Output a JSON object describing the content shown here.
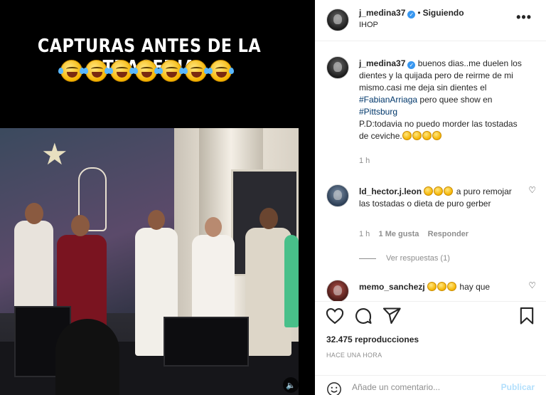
{
  "media": {
    "caption": "CAPTURAS ANTES DE LA TRAGEDIA",
    "emoji_row": [
      "rolling-on-floor-laughing",
      "rolling-on-floor-laughing",
      "rolling-on-floor-laughing",
      "rolling-on-floor-laughing",
      "rolling-on-floor-laughing",
      "rolling-on-floor-laughing",
      "rolling-on-floor-laughing"
    ],
    "volume_icon": "speaker-icon"
  },
  "header": {
    "username": "j_medina37",
    "separator": "•",
    "follow_status": "Siguiendo",
    "location": "IHOP",
    "more_icon": "•••"
  },
  "post_caption": {
    "username": "j_medina37",
    "text_1": "buenos dias..me duelen los dientes y la quijada pero de reirme de mi mismo.casi me deja sin dientes el",
    "hashtag_1": "#FabianArriaga",
    "text_2": "pero quee show en",
    "hashtag_2": "#Pittsburg",
    "text_3": "P.D:todavia no puedo morder las tostadas de ceviche.",
    "time": "1 h"
  },
  "comments": [
    {
      "username": "ld_hector.j.leon",
      "text": "a puro remojar las tostadas o dieta de puro gerber",
      "time": "1 h",
      "likes": "1 Me gusta",
      "reply": "Responder",
      "view_replies": "Ver respuestas (1)"
    },
    {
      "username": "memo_sanchezj",
      "text": "hay que"
    }
  ],
  "stats": {
    "views": "32.475 reproducciones",
    "posted": "HACE UNA HORA"
  },
  "add_comment": {
    "placeholder": "Añade un comentario...",
    "post_label": "Publicar"
  },
  "colors": {
    "link": "#00376b",
    "verified": "#3897f0",
    "muted": "#8e8e8e",
    "post_disabled": "#b2dffc"
  }
}
